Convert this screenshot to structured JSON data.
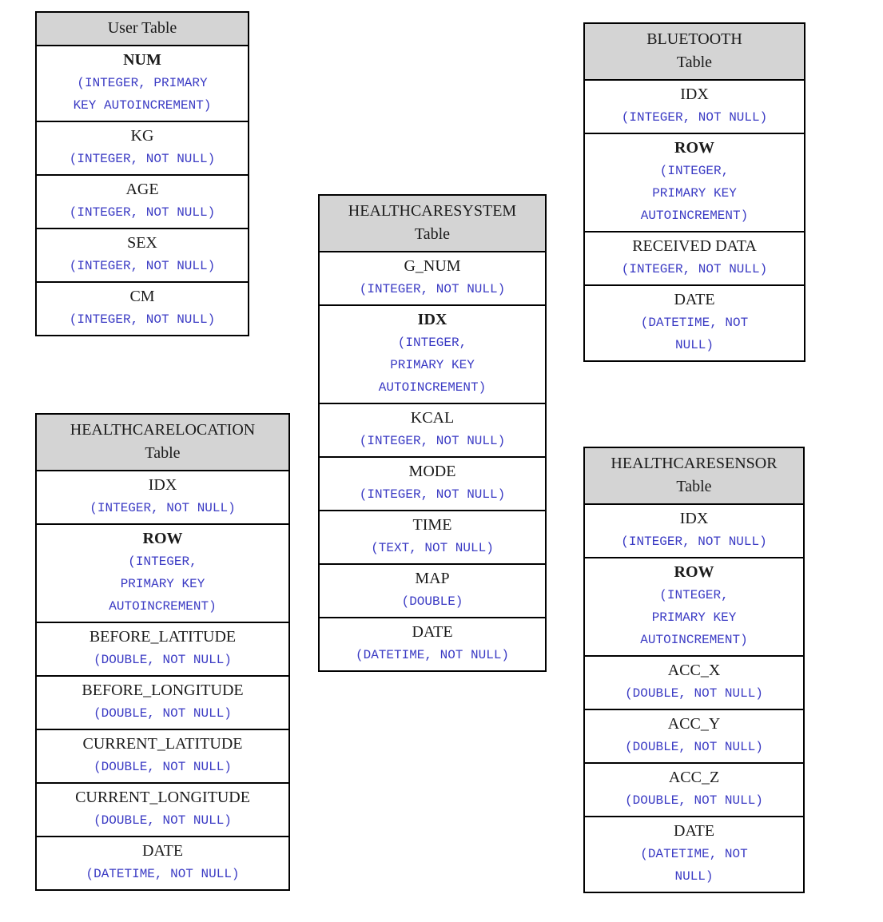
{
  "diagram": {
    "type": "database-schema",
    "background_color": "#ffffff",
    "header_fill_color": "#d4d4d4",
    "border_color": "#000000",
    "field_name_color": "#1a1a1a",
    "field_type_color": "#3b3bc4"
  },
  "tables": [
    {
      "id": "user",
      "title_lines": [
        "User Table"
      ],
      "fields": [
        {
          "name": "NUM",
          "primary_key": true,
          "type_lines": [
            "(INTEGER, PRIMARY",
            "KEY AUTOINCREMENT)"
          ]
        },
        {
          "name": "KG",
          "primary_key": false,
          "type_lines": [
            "(INTEGER, NOT NULL)"
          ]
        },
        {
          "name": "AGE",
          "primary_key": false,
          "type_lines": [
            "(INTEGER, NOT NULL)"
          ]
        },
        {
          "name": "SEX",
          "primary_key": false,
          "type_lines": [
            "(INTEGER, NOT NULL)"
          ]
        },
        {
          "name": "CM",
          "primary_key": false,
          "type_lines": [
            "(INTEGER, NOT NULL)"
          ]
        }
      ]
    },
    {
      "id": "bluetooth",
      "title_lines": [
        "BLUETOOTH",
        "Table"
      ],
      "fields": [
        {
          "name": "IDX",
          "primary_key": false,
          "type_lines": [
            "(INTEGER, NOT NULL)"
          ]
        },
        {
          "name": "ROW",
          "primary_key": true,
          "type_lines": [
            "(INTEGER,",
            "PRIMARY KEY",
            "AUTOINCREMENT)"
          ]
        },
        {
          "name": "RECEIVED DATA",
          "primary_key": false,
          "type_lines": [
            "(INTEGER, NOT NULL)"
          ]
        },
        {
          "name": "DATE",
          "primary_key": false,
          "type_lines": [
            "(DATETIME, NOT",
            "NULL)"
          ]
        }
      ]
    },
    {
      "id": "healthcaresystem",
      "title_lines": [
        "HEALTHCARESYSTEM",
        "Table"
      ],
      "fields": [
        {
          "name": "G_NUM",
          "primary_key": false,
          "type_lines": [
            "(INTEGER, NOT NULL)"
          ]
        },
        {
          "name": "IDX",
          "primary_key": true,
          "type_lines": [
            "(INTEGER,",
            "PRIMARY KEY",
            "AUTOINCREMENT)"
          ]
        },
        {
          "name": "KCAL",
          "primary_key": false,
          "type_lines": [
            "(INTEGER, NOT NULL)"
          ]
        },
        {
          "name": "MODE",
          "primary_key": false,
          "type_lines": [
            "(INTEGER, NOT NULL)"
          ]
        },
        {
          "name": "TIME",
          "primary_key": false,
          "type_lines": [
            "(TEXT, NOT NULL)"
          ]
        },
        {
          "name": "MAP",
          "primary_key": false,
          "type_lines": [
            "(DOUBLE)"
          ]
        },
        {
          "name": "DATE",
          "primary_key": false,
          "type_lines": [
            "(DATETIME, NOT NULL)"
          ]
        }
      ]
    },
    {
      "id": "healthcarelocation",
      "title_lines": [
        "HEALTHCARELOCATION",
        "Table"
      ],
      "fields": [
        {
          "name": "IDX",
          "primary_key": false,
          "type_lines": [
            "(INTEGER, NOT NULL)"
          ]
        },
        {
          "name": "ROW",
          "primary_key": true,
          "type_lines": [
            "(INTEGER,",
            "PRIMARY KEY",
            "AUTOINCREMENT)"
          ]
        },
        {
          "name": "BEFORE_LATITUDE",
          "primary_key": false,
          "type_lines": [
            "(DOUBLE, NOT NULL)"
          ]
        },
        {
          "name": "BEFORE_LONGITUDE",
          "primary_key": false,
          "type_lines": [
            "(DOUBLE, NOT NULL)"
          ]
        },
        {
          "name": "CURRENT_LATITUDE",
          "primary_key": false,
          "type_lines": [
            "(DOUBLE, NOT NULL)"
          ]
        },
        {
          "name": "CURRENT_LONGITUDE",
          "primary_key": false,
          "type_lines": [
            "(DOUBLE, NOT NULL)"
          ]
        },
        {
          "name": "DATE",
          "primary_key": false,
          "type_lines": [
            "(DATETIME, NOT NULL)"
          ]
        }
      ]
    },
    {
      "id": "healthcaresensor",
      "title_lines": [
        "HEALTHCARESENSOR",
        "Table"
      ],
      "fields": [
        {
          "name": "IDX",
          "primary_key": false,
          "type_lines": [
            "(INTEGER, NOT NULL)"
          ]
        },
        {
          "name": "ROW",
          "primary_key": true,
          "type_lines": [
            "(INTEGER,",
            "PRIMARY KEY",
            "AUTOINCREMENT)"
          ]
        },
        {
          "name": "ACC_X",
          "primary_key": false,
          "type_lines": [
            "(DOUBLE, NOT NULL)"
          ]
        },
        {
          "name": "ACC_Y",
          "primary_key": false,
          "type_lines": [
            "(DOUBLE, NOT NULL)"
          ]
        },
        {
          "name": "ACC_Z",
          "primary_key": false,
          "type_lines": [
            "(DOUBLE, NOT NULL)"
          ]
        },
        {
          "name": "DATE",
          "primary_key": false,
          "type_lines": [
            "(DATETIME, NOT",
            "NULL)"
          ]
        }
      ]
    }
  ]
}
